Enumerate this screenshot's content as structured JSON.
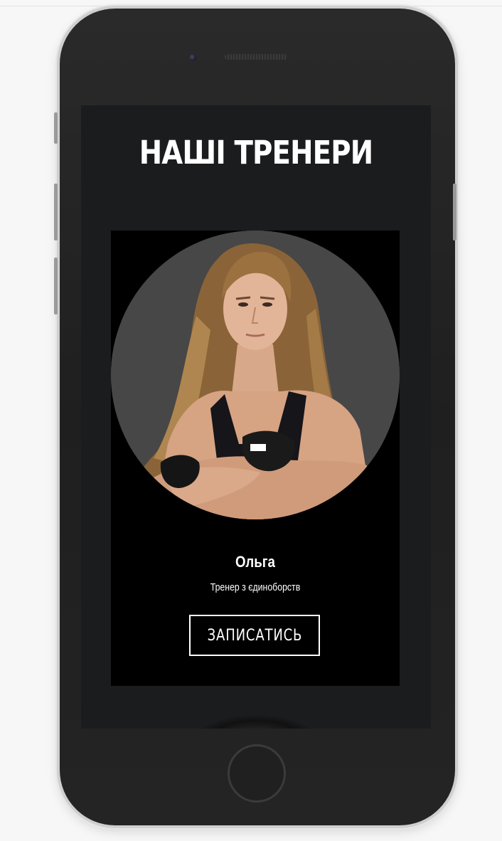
{
  "page": {
    "title": "НАШІ ТРЕНЕРИ"
  },
  "trainer": {
    "name": "Ольга",
    "role": "Тренер з єдиноборств",
    "signup_label": "ЗАПИСАТИСЬ",
    "photo_icon": "trainer-portrait"
  },
  "colors": {
    "screen_bg": "#1b1c1e",
    "card_bg": "#000000",
    "text": "#ffffff",
    "phone_body": "#222222"
  }
}
